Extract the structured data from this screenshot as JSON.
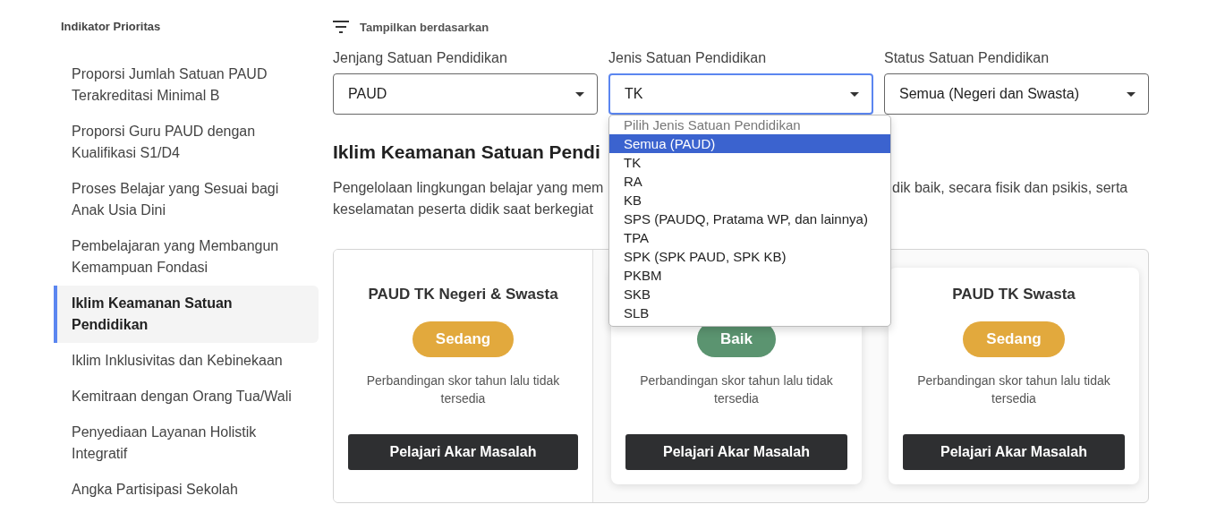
{
  "sidebar": {
    "title": "Indikator Prioritas",
    "items": [
      {
        "label": "Proporsi Jumlah Satuan PAUD Terakreditasi Minimal B",
        "selected": false
      },
      {
        "label": "Proporsi Guru PAUD dengan Kualifikasi S1/D4",
        "selected": false
      },
      {
        "label": "Proses Belajar yang Sesuai bagi Anak Usia Dini",
        "selected": false
      },
      {
        "label": "Pembelajaran yang Membangun Kemampuan Fondasi",
        "selected": false
      },
      {
        "label": "Iklim Keamanan Satuan Pendidikan",
        "selected": true
      },
      {
        "label": "Iklim Inklusivitas dan Kebinekaan",
        "selected": false
      },
      {
        "label": "Kemitraan dengan Orang Tua/Wali",
        "selected": false
      },
      {
        "label": "Penyediaan Layanan Holistik Integratif",
        "selected": false
      },
      {
        "label": "Angka Partisipasi Sekolah",
        "selected": false
      }
    ]
  },
  "filter": {
    "label": "Tampilkan berdasarkan",
    "selects": [
      {
        "label": "Jenjang Satuan Pendidikan",
        "value": "PAUD",
        "focused": false
      },
      {
        "label": "Jenis Satuan Pendidikan",
        "value": "TK",
        "focused": true
      },
      {
        "label": "Status Satuan Pendidikan",
        "value": "Semua (Negeri dan Swasta)",
        "focused": false
      }
    ]
  },
  "dropdown": {
    "prompt": "Pilih Jenis Satuan Pendidikan",
    "options": [
      {
        "label": "Semua (PAUD)",
        "selected": true
      },
      {
        "label": "TK",
        "selected": false
      },
      {
        "label": "RA",
        "selected": false
      },
      {
        "label": "KB",
        "selected": false
      },
      {
        "label": "SPS (PAUDQ, Pratama WP, dan lainnya)",
        "selected": false
      },
      {
        "label": "TPA",
        "selected": false
      },
      {
        "label": "SPK (SPK PAUD, SPK KB)",
        "selected": false
      },
      {
        "label": "PKBM",
        "selected": false
      },
      {
        "label": "SKB",
        "selected": false
      },
      {
        "label": "SLB",
        "selected": false
      }
    ]
  },
  "section": {
    "title": "Iklim Keamanan Satuan Pendi",
    "description_line_1_left": "Pengelolaan lingkungan belajar yang mem",
    "description_line_1_right": "dik baik, secara fisik dan psikis, serta",
    "description_line_2": "keselamatan peserta didik saat berkegiat"
  },
  "cards": [
    {
      "kind": "flat",
      "title": "PAUD TK Negeri & Swasta",
      "badge": "Sedang",
      "color": "#e2a93d",
      "note": "Perbandingan skor tahun lalu tidak tersedia",
      "button": "Pelajari Akar Masalah"
    },
    {
      "kind": "raised",
      "badge": "Baik",
      "color": "#5b9470",
      "note": "Perbandingan skor tahun lalu tidak tersedia",
      "button": "Pelajari Akar Masalah"
    },
    {
      "kind": "raised",
      "title": "PAUD TK Swasta",
      "badge": "Sedang",
      "color": "#e2a93d",
      "note": "Perbandingan skor tahun lalu tidak tersedia",
      "button": "Pelajari Akar Masalah"
    }
  ]
}
